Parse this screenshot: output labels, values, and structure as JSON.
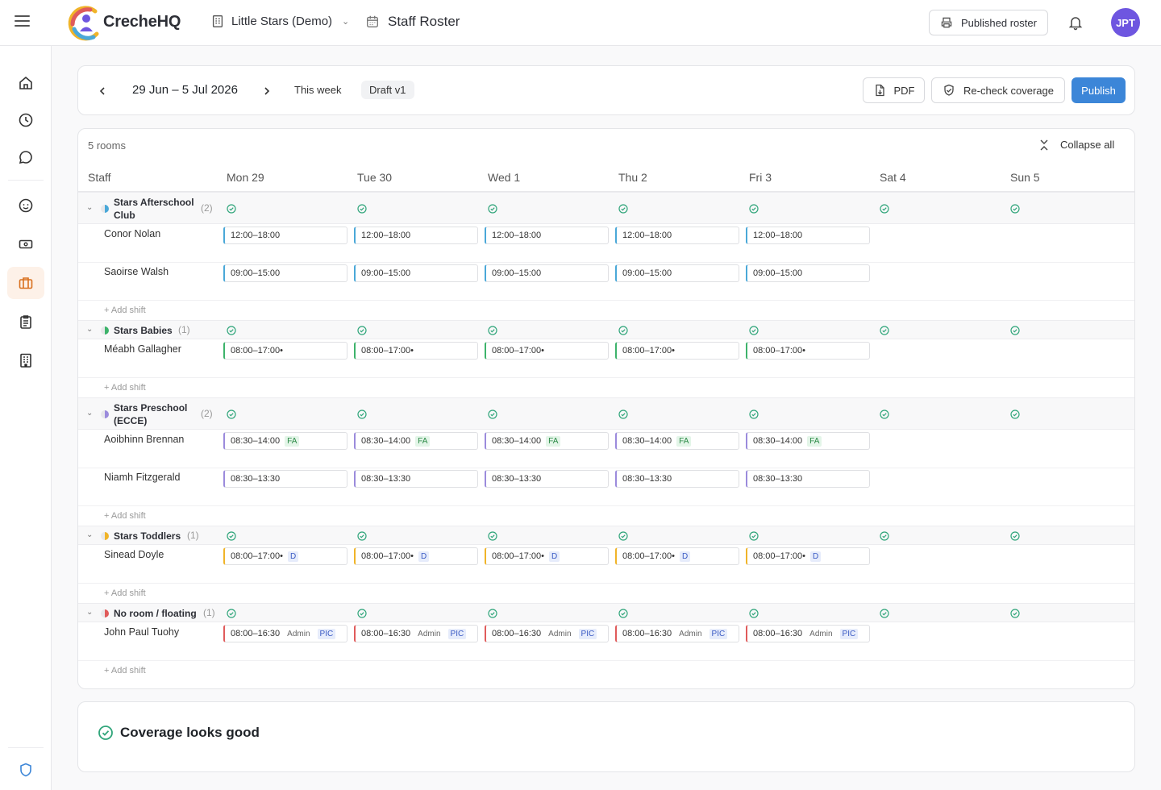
{
  "app": {
    "brand": "CrecheHQ",
    "org": "Little Stars (Demo)",
    "page_title": "Staff Roster",
    "published_roster_label": "Published roster",
    "avatar_initials": "JPT",
    "avatar_color": "#6e56e0"
  },
  "sidebar": {
    "items": [
      "home-icon",
      "clock-icon",
      "chat-icon",
      "child-face-icon",
      "money-icon",
      "briefcase-icon",
      "clipboard-icon",
      "building-icon",
      "shield-icon"
    ],
    "active": "briefcase-icon"
  },
  "toolbar": {
    "date_range": "29 Jun – 5 Jul 2026",
    "this_week_label": "This week",
    "draft_label": "Draft v1",
    "pdf_label": "PDF",
    "recheck_label": "Re-check coverage",
    "publish_label": "Publish"
  },
  "roster": {
    "rooms_count": "5 rooms",
    "collapse_all_label": "Collapse all",
    "add_shift_label": "+ Add shift",
    "columns": [
      "Staff",
      "Mon 29",
      "Tue 30",
      "Wed 1",
      "Thu 2",
      "Fri 3",
      "Sat 4",
      "Sun 5"
    ],
    "rooms": [
      {
        "name": "Stars Afterschool Club",
        "count": "(2)",
        "color": "#4aa8d8",
        "staff": [
          {
            "name": "Conor Nolan",
            "time": "12:00–18:00",
            "tags": []
          },
          {
            "name": "Saoirse Walsh",
            "time": "09:00–15:00",
            "tags": []
          }
        ]
      },
      {
        "name": "Stars Babies",
        "count": "(1)",
        "color": "#3db36b",
        "staff": [
          {
            "name": "Méabh Gallagher",
            "time": "08:00–17:00•",
            "tags": []
          }
        ]
      },
      {
        "name": "Stars Preschool (ECCE)",
        "count": "(2)",
        "color": "#9b8bdc",
        "staff": [
          {
            "name": "Aoibhinn Brennan",
            "time": "08:30–14:00",
            "tags": [
              "FA"
            ]
          },
          {
            "name": "Niamh Fitzgerald",
            "time": "08:30–13:30",
            "tags": []
          }
        ]
      },
      {
        "name": "Stars Toddlers",
        "count": "(1)",
        "color": "#f0b429",
        "staff": [
          {
            "name": "Sinead Doyle",
            "time": "08:00–17:00•",
            "tags": [
              "D"
            ]
          }
        ]
      },
      {
        "name": "No room / floating",
        "count": "(1)",
        "color": "#e05b5b",
        "staff": [
          {
            "name": "John Paul Tuohy",
            "time": "08:00–16:30",
            "tags": [
              "Admin",
              "PIC"
            ]
          }
        ]
      }
    ]
  },
  "coverage": {
    "message": "Coverage looks good",
    "status_color": "#2fa57a"
  }
}
